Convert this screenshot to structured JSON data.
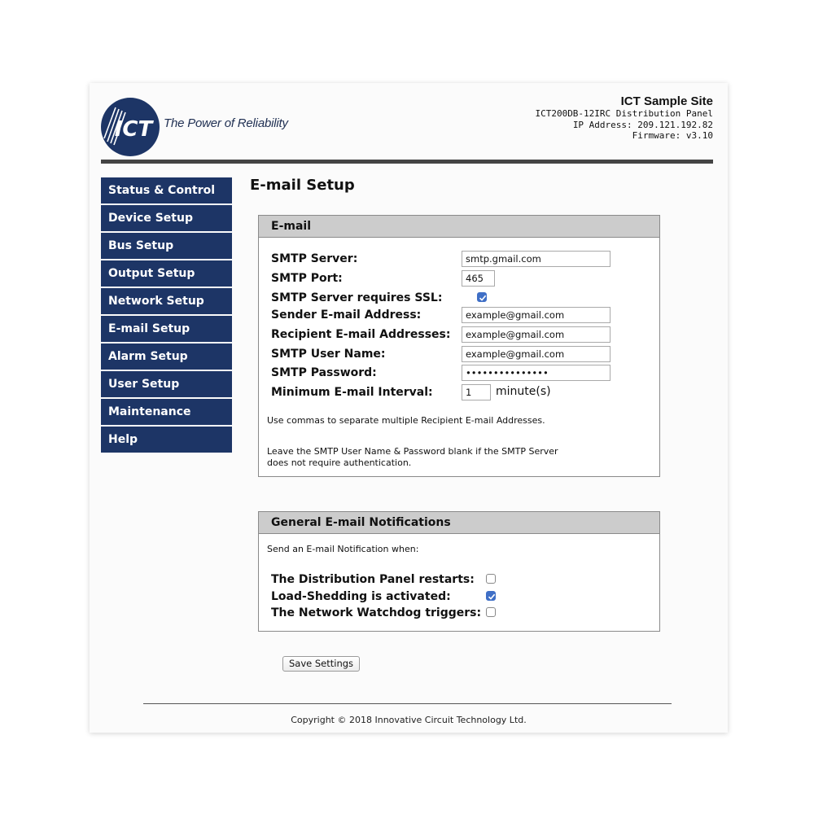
{
  "header": {
    "logo_text": "ICT",
    "tagline": "The Power of Reliability",
    "site_name": "ICT Sample Site",
    "model_line": "ICT200DB-12IRC Distribution Panel",
    "ip_line": "IP Address: 209.121.192.82",
    "firmware_line": "Firmware: v3.10"
  },
  "sidebar": {
    "items": [
      {
        "label": "Status & Control"
      },
      {
        "label": "Device Setup"
      },
      {
        "label": "Bus Setup"
      },
      {
        "label": "Output Setup"
      },
      {
        "label": "Network Setup"
      },
      {
        "label": "E-mail Setup"
      },
      {
        "label": "Alarm Setup"
      },
      {
        "label": "User Setup"
      },
      {
        "label": "Maintenance"
      },
      {
        "label": "Help"
      }
    ]
  },
  "main": {
    "title": "E-mail Setup",
    "email_panel": {
      "heading": "E-mail",
      "smtp_server": {
        "label": "SMTP Server:",
        "value": "smtp.gmail.com"
      },
      "smtp_port": {
        "label": "SMTP Port:",
        "value": "465"
      },
      "ssl": {
        "label": "SMTP Server requires SSL:",
        "checked": true
      },
      "sender": {
        "label": "Sender E-mail Address:",
        "value": "example@gmail.com"
      },
      "recipients": {
        "label": "Recipient E-mail Addresses:",
        "value": "example@gmail.com"
      },
      "user_name": {
        "label": "SMTP User Name:",
        "value": "example@gmail.com"
      },
      "password": {
        "label": "SMTP Password:",
        "value": "•••••••••••••••"
      },
      "interval": {
        "label": "Minimum E-mail Interval:",
        "value": "1",
        "unit": "minute(s)"
      },
      "note1": "Use commas to separate multiple Recipient E-mail Addresses.",
      "note2_line1": "Leave the SMTP User Name & Password blank if the SMTP Server",
      "note2_line2": "does not require authentication."
    },
    "notifications_panel": {
      "heading": "General E-mail Notifications",
      "intro": "Send an E-mail Notification when:",
      "items": [
        {
          "label": "The Distribution Panel restarts:",
          "checked": false
        },
        {
          "label": "Load-Shedding is activated:",
          "checked": true
        },
        {
          "label": "The Network Watchdog triggers:",
          "checked": false
        }
      ]
    },
    "save_label": "Save Settings"
  },
  "footer": {
    "copyright": "Copyright © 2018 Innovative Circuit Technology Ltd."
  },
  "colors": {
    "nav_bg": "#1d3566",
    "logo_blue": "#1d3566",
    "checkbox_on": "#3f6fc6",
    "panel_header": "#cccccc"
  }
}
